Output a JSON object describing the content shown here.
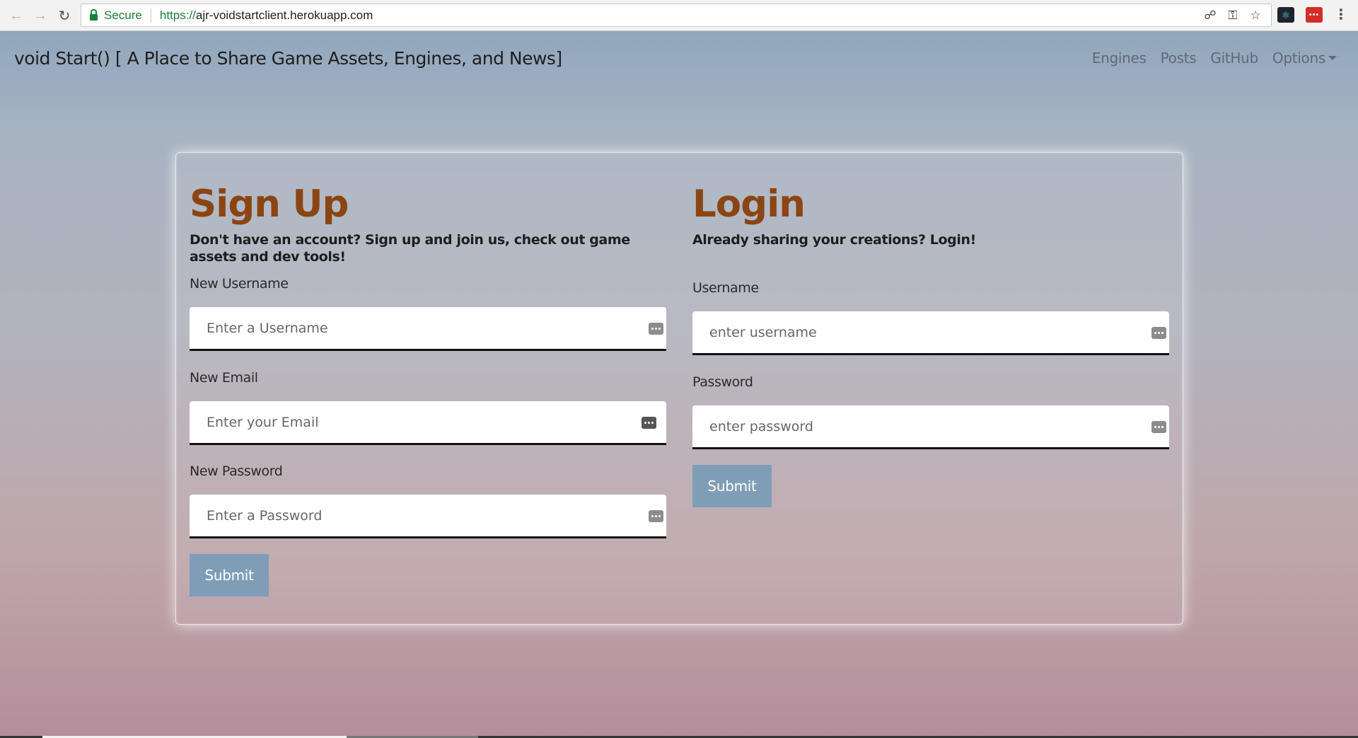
{
  "browser": {
    "secure_label": "Secure",
    "url_scheme": "https://",
    "url_host": "ajr-voidstartclient.herokuapp.com",
    "icons": [
      "back-arrow-icon",
      "forward-arrow-icon",
      "reload-icon",
      "lock-icon",
      "translate-icon",
      "key-icon",
      "star-icon",
      "react-devtools-icon",
      "lastpass-icon",
      "more-vert-icon"
    ]
  },
  "navbar": {
    "brand": "void Start() [ A Place to Share Game Assets, Engines, and News]",
    "links": [
      "Engines",
      "Posts",
      "GitHub",
      "Options"
    ]
  },
  "signup": {
    "title": "Sign Up",
    "subtitle": "Don't have an account? Sign up and join us, check out game assets and dev tools!",
    "username_label": "New Username",
    "username_placeholder": "Enter a Username",
    "email_label": "New Email",
    "email_placeholder": "Enter your Email",
    "password_label": "New Password",
    "password_placeholder": "Enter a Password",
    "submit": "Submit"
  },
  "login": {
    "title": "Login",
    "subtitle": "Already sharing your creations? Login!",
    "username_label": "Username",
    "username_placeholder": "enter username",
    "password_label": "Password",
    "password_placeholder": "enter password",
    "submit": "Submit"
  },
  "colors": {
    "heading": "#8b4513",
    "button": "#7f9db7",
    "nav_link": "#5f6a78"
  }
}
